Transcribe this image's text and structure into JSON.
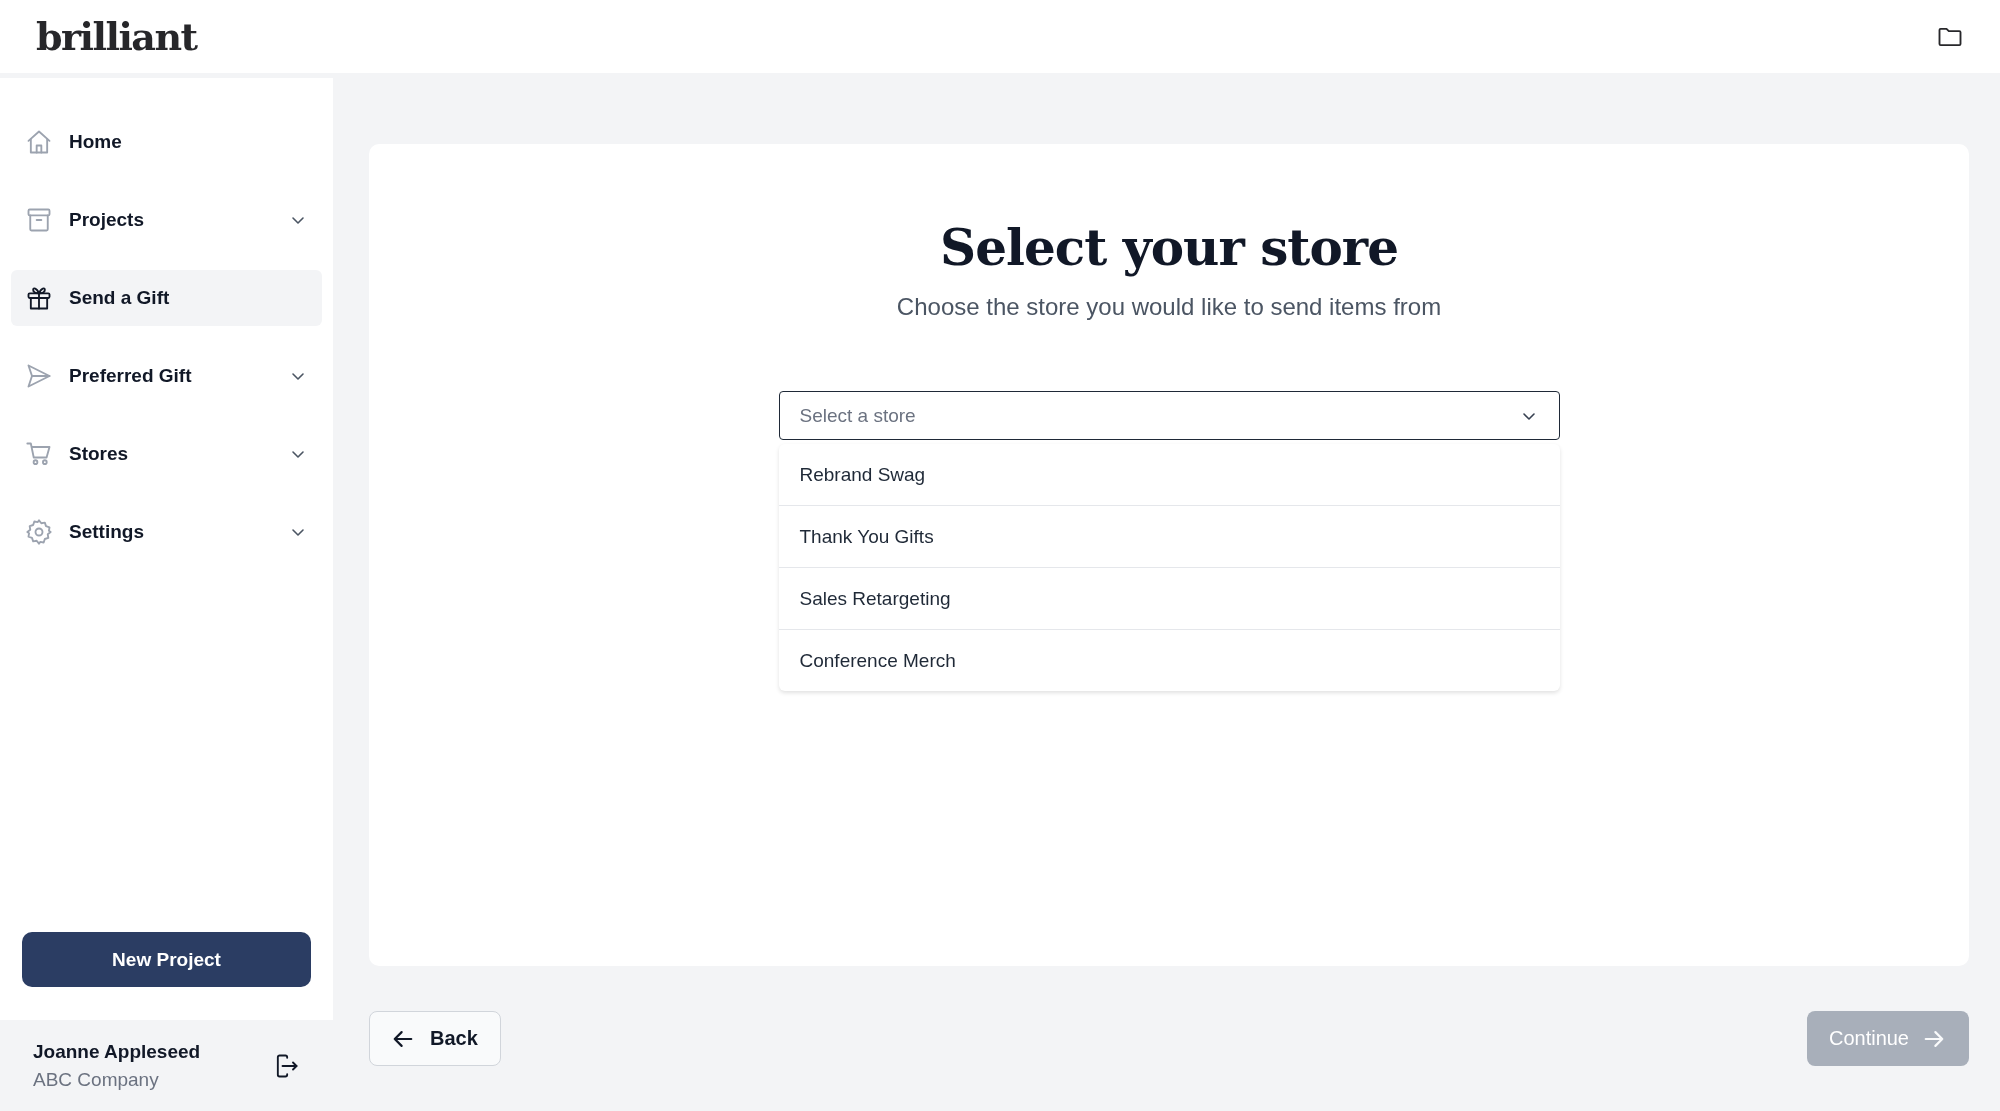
{
  "header": {
    "logo": "brilliant"
  },
  "sidebar": {
    "items": [
      {
        "label": "Home",
        "selected": false,
        "expandable": false
      },
      {
        "label": "Projects",
        "selected": false,
        "expandable": true
      },
      {
        "label": "Send a Gift",
        "selected": true,
        "expandable": false
      },
      {
        "label": "Preferred Gift",
        "selected": false,
        "expandable": true
      },
      {
        "label": "Stores",
        "selected": false,
        "expandable": true
      },
      {
        "label": "Settings",
        "selected": false,
        "expandable": true
      }
    ],
    "new_project_button": "New Project",
    "user": {
      "name": "Joanne Appleseed",
      "company": "ABC Company"
    }
  },
  "main": {
    "title": "Select your store",
    "subtitle": "Choose the store you would like to send items from",
    "store_select": {
      "placeholder": "Select a store",
      "expanded": true,
      "options": [
        {
          "label": "Rebrand Swag",
          "selected": false
        },
        {
          "label": "Thank You Gifts",
          "selected": false
        },
        {
          "label": "Sales Retargeting",
          "selected": false
        },
        {
          "label": "Conference Merch",
          "selected": false
        }
      ]
    }
  },
  "footer": {
    "back_button": "Back",
    "continue_button": {
      "label": "Continue",
      "disabled": true
    }
  }
}
